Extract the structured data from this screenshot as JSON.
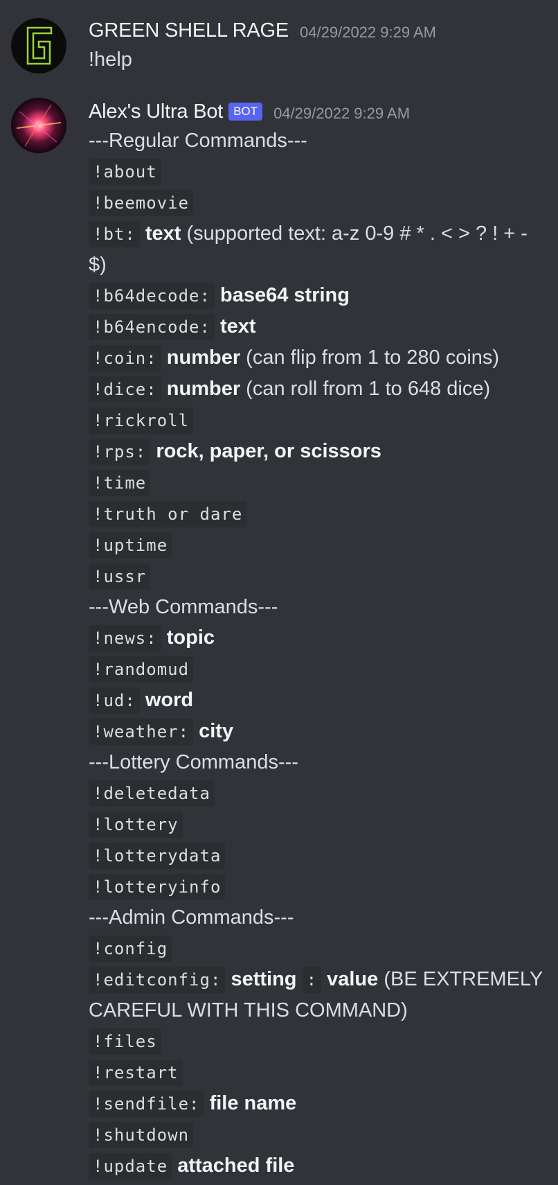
{
  "messages": [
    {
      "author": "GREEN SHELL RAGE",
      "timestamp": "04/29/2022 9:29 AM",
      "content": "!help"
    },
    {
      "author": "Alex's Ultra Bot",
      "tag": "BOT",
      "timestamp": "04/29/2022 9:29 AM",
      "headers": {
        "regular": "---Regular Commands---",
        "web": "---Web Commands---",
        "lottery": "---Lottery Commands---",
        "admin": "---Admin Commands---"
      },
      "commands": {
        "about": "!about",
        "beemovie": "!beemovie",
        "bt": {
          "cmd": "!bt:",
          "arg": "text",
          "note": "(supported text: a-z 0-9 # * . < > ? ! + - $)"
        },
        "b64decode": {
          "cmd": "!b64decode:",
          "arg": "base64 string"
        },
        "b64encode": {
          "cmd": "!b64encode:",
          "arg": "text"
        },
        "coin": {
          "cmd": "!coin:",
          "arg": "number",
          "note": "(can flip from 1 to 280 coins)"
        },
        "dice": {
          "cmd": "!dice:",
          "arg": "number",
          "note": "(can roll from 1 to 648 dice)"
        },
        "rickroll": "!rickroll",
        "rps": {
          "cmd": "!rps:",
          "arg": "rock, paper, or scissors"
        },
        "time": "!time",
        "truth_or_dare": "!truth or dare",
        "uptime": "!uptime",
        "ussr": "!ussr",
        "news": {
          "cmd": "!news:",
          "arg": "topic"
        },
        "randomud": "!randomud",
        "ud": {
          "cmd": "!ud:",
          "arg": "word"
        },
        "weather": {
          "cmd": "!weather:",
          "arg": "city"
        },
        "deletedata": "!deletedata",
        "lottery": "!lottery",
        "lotterydata": "!lotterydata",
        "lotteryinfo": "!lotteryinfo",
        "config": "!config",
        "editconfig": {
          "cmd": "!editconfig:",
          "arg": "setting",
          "sep": ":",
          "arg2": "value",
          "note": "(BE EXTREMELY CAREFUL WITH THIS COMMAND)"
        },
        "files": "!files",
        "restart": "!restart",
        "sendfile": {
          "cmd": "!sendfile:",
          "arg": "file name"
        },
        "shutdown": "!shutdown",
        "update": {
          "cmd": "!update",
          "arg": "attached file"
        }
      }
    }
  ]
}
